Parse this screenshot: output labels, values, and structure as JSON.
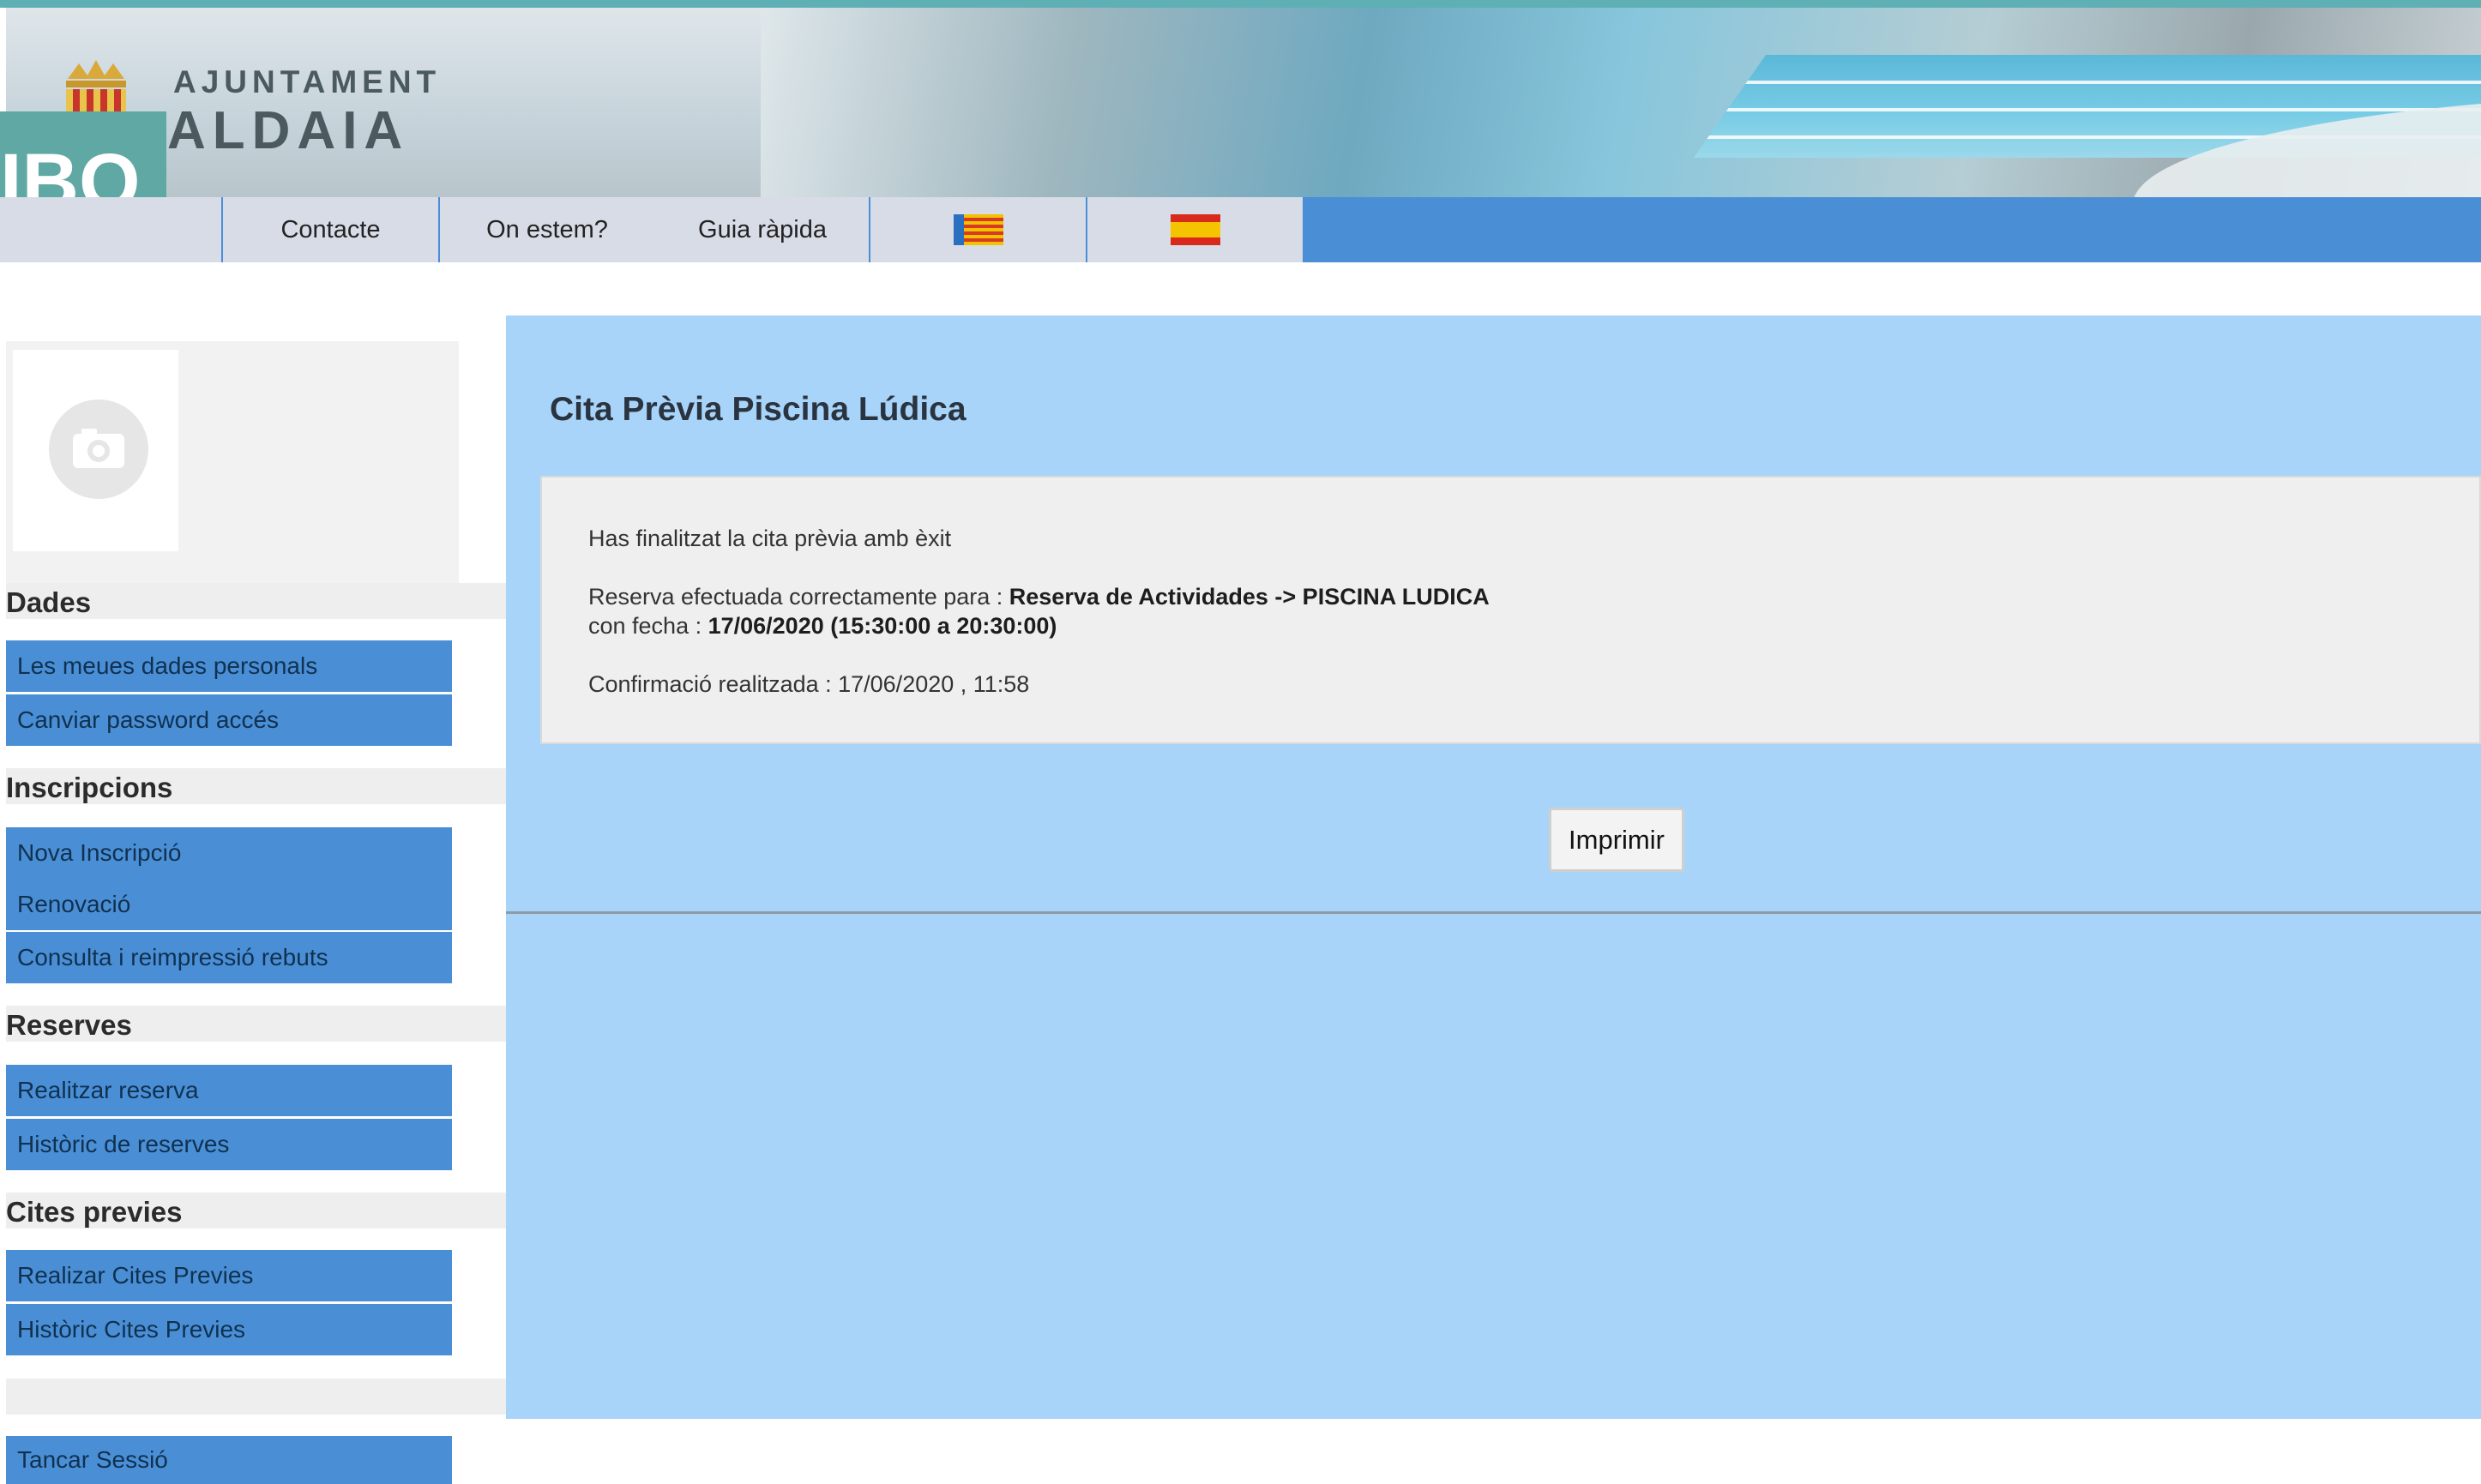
{
  "header": {
    "org_prefix": "AJUNTAMENT",
    "org_name": "ALDAIA",
    "badge_text": "IBO"
  },
  "nav": {
    "items": [
      {
        "label": "Contacte"
      },
      {
        "label": "On estem?"
      },
      {
        "label": "Guia ràpida"
      }
    ],
    "flags": [
      "valencian-flag-icon",
      "spain-flag-icon"
    ]
  },
  "sidebar": {
    "photo_icon": "camera-icon",
    "sections": {
      "dades": {
        "title": "Dades",
        "items": [
          "Les meues dades personals",
          "Canviar password accés"
        ]
      },
      "inscripcions": {
        "title": "Inscripcions",
        "items": [
          "Nova Inscripció",
          "Renovació",
          "Consulta i reimpressió rebuts"
        ]
      },
      "reserves": {
        "title": "Reserves",
        "items": [
          "Realitzar reserva",
          "Històric de reserves"
        ]
      },
      "cites": {
        "title": "Cites previes",
        "items": [
          "Realizar Cites Previes",
          "Històric Cites Previes"
        ]
      }
    },
    "logout": "Tancar Sessió"
  },
  "main": {
    "title": "Cita Prèvia Piscina Lúdica",
    "message": {
      "success": "Has finalitzat la cita prèvia amb èxit",
      "reserva_prefix": "Reserva efectuada correctamente para : ",
      "reserva_value": "Reserva de Actividades -> PISCINA LUDICA",
      "fecha_prefix": "con fecha : ",
      "fecha_value": "17/06/2020 (15:30:00 a 20:30:00)",
      "confirm": "Confirmació realitzada : 17/06/2020 , 11:58"
    },
    "print_label": "Imprimir"
  }
}
